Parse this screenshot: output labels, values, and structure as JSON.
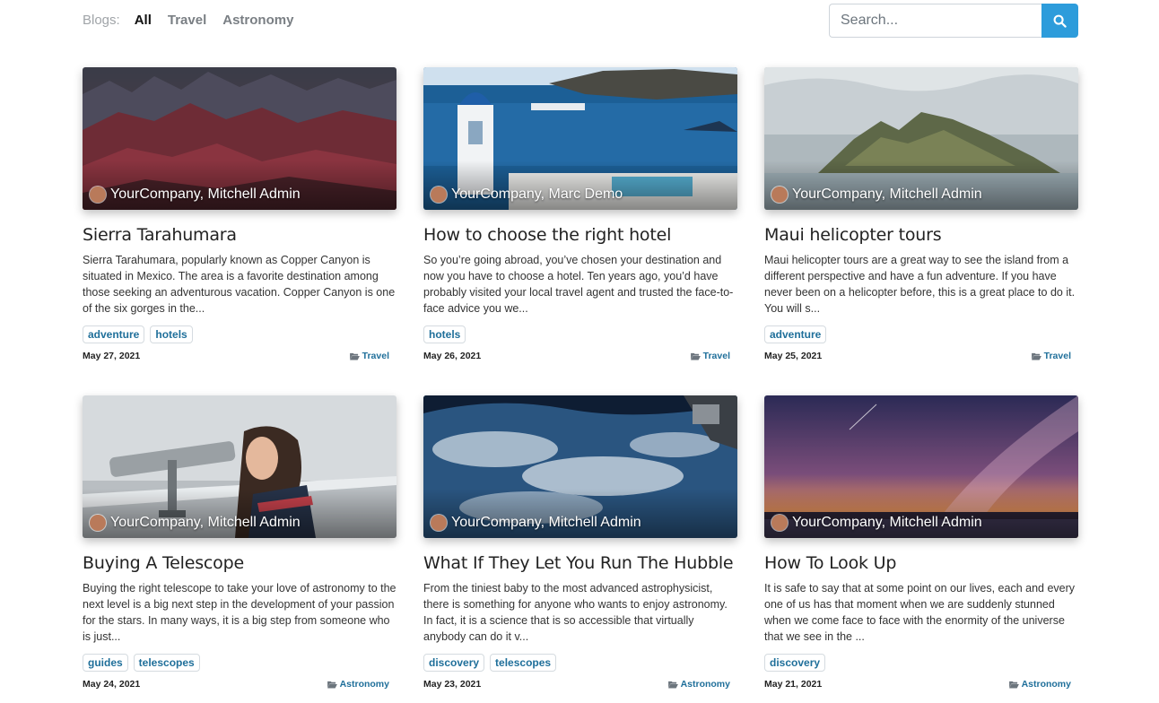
{
  "nav": {
    "label": "Blogs:",
    "items": [
      "All",
      "Travel",
      "Astronomy"
    ],
    "active": "All"
  },
  "search": {
    "placeholder": "Search..."
  },
  "posts": [
    {
      "author": "YourCompany, Mitchell Admin",
      "title": "Sierra Tarahumara",
      "excerpt": "Sierra Tarahumara, popularly known as Copper Canyon is situated in Mexico. The area is a favorite destination among those seeking an adventurous vacation. Copper Canyon is one of the six gorges in the...",
      "tags": [
        "adventure",
        "hotels"
      ],
      "date": "May 27, 2021",
      "category": "Travel"
    },
    {
      "author": "YourCompany, Marc Demo",
      "title": "How to choose the right hotel",
      "excerpt": "So you’re going abroad, you’ve chosen your destination and now you have to choose a hotel. Ten years ago, you’d have probably visited your local travel agent and trusted the face-to-face advice you we...",
      "tags": [
        "hotels"
      ],
      "date": "May 26, 2021",
      "category": "Travel"
    },
    {
      "author": "YourCompany, Mitchell Admin",
      "title": "Maui helicopter tours",
      "excerpt": "Maui helicopter tours are a great way to see the island from a different perspective and have a fun adventure. If you have never been on a helicopter before, this is a great place to do it. You will s...",
      "tags": [
        "adventure"
      ],
      "date": "May 25, 2021",
      "category": "Travel"
    },
    {
      "author": "YourCompany, Mitchell Admin",
      "title": "Buying A Telescope",
      "excerpt": "Buying the right telescope to take your love of astronomy to the next level is a big next step in the development of your passion for the stars. In many ways, it is a big step from someone who is just...",
      "tags": [
        "guides",
        "telescopes"
      ],
      "date": "May 24, 2021",
      "category": "Astronomy"
    },
    {
      "author": "YourCompany, Mitchell Admin",
      "title": "What If They Let You Run The Hubble",
      "excerpt": "From the tiniest baby to the most advanced astrophysicist, there is something for anyone who wants to enjoy astronomy. In fact, it is a science that is so accessible that virtually anybody can do it v...",
      "tags": [
        "discovery",
        "telescopes"
      ],
      "date": "May 23, 2021",
      "category": "Astronomy"
    },
    {
      "author": "YourCompany, Mitchell Admin",
      "title": "How To Look Up",
      "excerpt": "It is safe to say that at some point on our lives, each and every one of us has that moment when we are suddenly stunned when we come face to face with the enormity of the universe that we see in the ...",
      "tags": [
        "discovery"
      ],
      "date": "May 21, 2021",
      "category": "Astronomy"
    }
  ],
  "colors": {
    "accent": "#2d9cdb",
    "link": "#1f6f9a"
  },
  "icons": {
    "search": "search-icon",
    "category": "folder-open-icon"
  }
}
